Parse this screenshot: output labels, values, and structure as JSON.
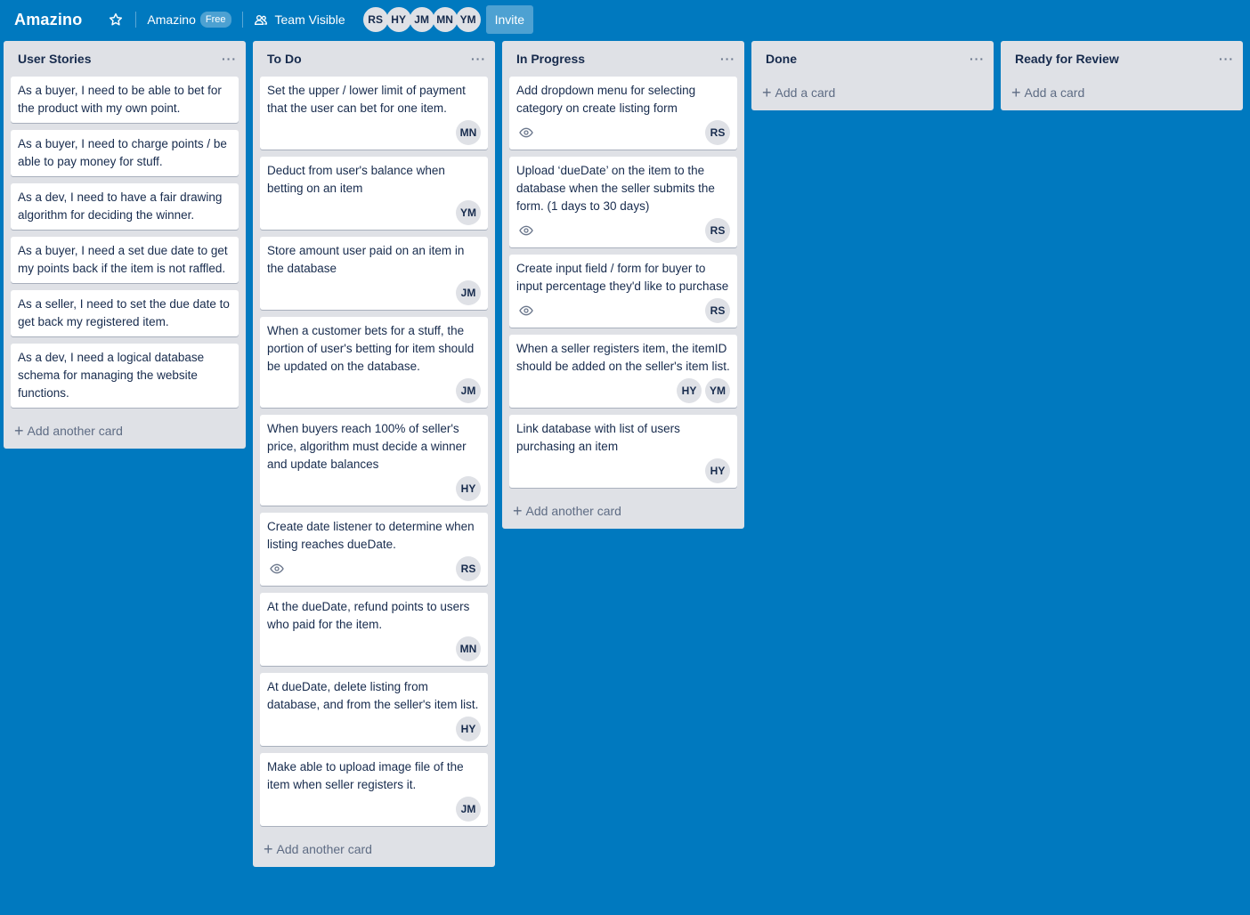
{
  "header": {
    "board_title": "Amazino",
    "team_name": "Amazino",
    "team_badge": "Free",
    "visibility": "Team Visible",
    "members": [
      "RS",
      "HY",
      "JM",
      "MN",
      "YM"
    ],
    "invite_label": "Invite"
  },
  "lists": [
    {
      "title": "User Stories",
      "add_label": "Add another card",
      "cards": [
        {
          "text": "As a buyer, I need to be able to bet for the product with my own point.",
          "members": [],
          "watch": false
        },
        {
          "text": "As a buyer, I need to charge points / be able to pay money for stuff.",
          "members": [],
          "watch": false
        },
        {
          "text": "As a dev, I need to have a fair drawing algorithm for deciding the winner.",
          "members": [],
          "watch": false
        },
        {
          "text": "As a buyer, I need a set due date to get my points back if the item is not raffled.",
          "members": [],
          "watch": false
        },
        {
          "text": "As a seller, I need to set the due date to get back my registered item.",
          "members": [],
          "watch": false
        },
        {
          "text": "As a dev, I need a logical database schema for managing the website functions.",
          "members": [],
          "watch": false
        }
      ]
    },
    {
      "title": "To Do",
      "add_label": "Add another card",
      "cards": [
        {
          "text": "Set the upper / lower limit of payment that the user can bet for one item.",
          "members": [
            "MN"
          ],
          "watch": false
        },
        {
          "text": "Deduct from user's balance when betting on an item",
          "members": [
            "YM"
          ],
          "watch": false
        },
        {
          "text": "Store amount user paid on an item in the database",
          "members": [
            "JM"
          ],
          "watch": false
        },
        {
          "text": "When a customer bets for a stuff, the portion of user's betting for item should be updated on the database.",
          "members": [
            "JM"
          ],
          "watch": false
        },
        {
          "text": "When buyers reach 100% of seller's price, algorithm must decide a winner and update balances",
          "members": [
            "HY"
          ],
          "watch": false
        },
        {
          "text": "Create date listener to determine when listing reaches dueDate.",
          "members": [
            "RS"
          ],
          "watch": true
        },
        {
          "text": "At the dueDate, refund points to users who paid for the item.",
          "members": [
            "MN"
          ],
          "watch": false
        },
        {
          "text": "At dueDate, delete listing from database, and from the seller's item list.",
          "members": [
            "HY"
          ],
          "watch": false
        },
        {
          "text": "Make able to upload image file of the item when seller registers it.",
          "members": [
            "JM"
          ],
          "watch": false
        }
      ]
    },
    {
      "title": "In Progress",
      "add_label": "Add another card",
      "cards": [
        {
          "text": "Add dropdown menu for selecting category on create listing form",
          "members": [
            "RS"
          ],
          "watch": true
        },
        {
          "text": "Upload ‘dueDate’ on the item to the database when the seller submits the form. (1 days to 30 days)",
          "members": [
            "RS"
          ],
          "watch": true
        },
        {
          "text": "Create input field / form for buyer to input percentage they'd like to purchase",
          "members": [
            "RS"
          ],
          "watch": true
        },
        {
          "text": "When a seller registers item, the itemID should be added on the seller's item list.",
          "members": [
            "HY",
            "YM"
          ],
          "watch": false
        },
        {
          "text": "Link database with list of users purchasing an item",
          "members": [
            "HY"
          ],
          "watch": false
        }
      ]
    },
    {
      "title": "Done",
      "add_label": "Add a card",
      "cards": []
    },
    {
      "title": "Ready for Review",
      "add_label": "Add a card",
      "cards": []
    }
  ]
}
